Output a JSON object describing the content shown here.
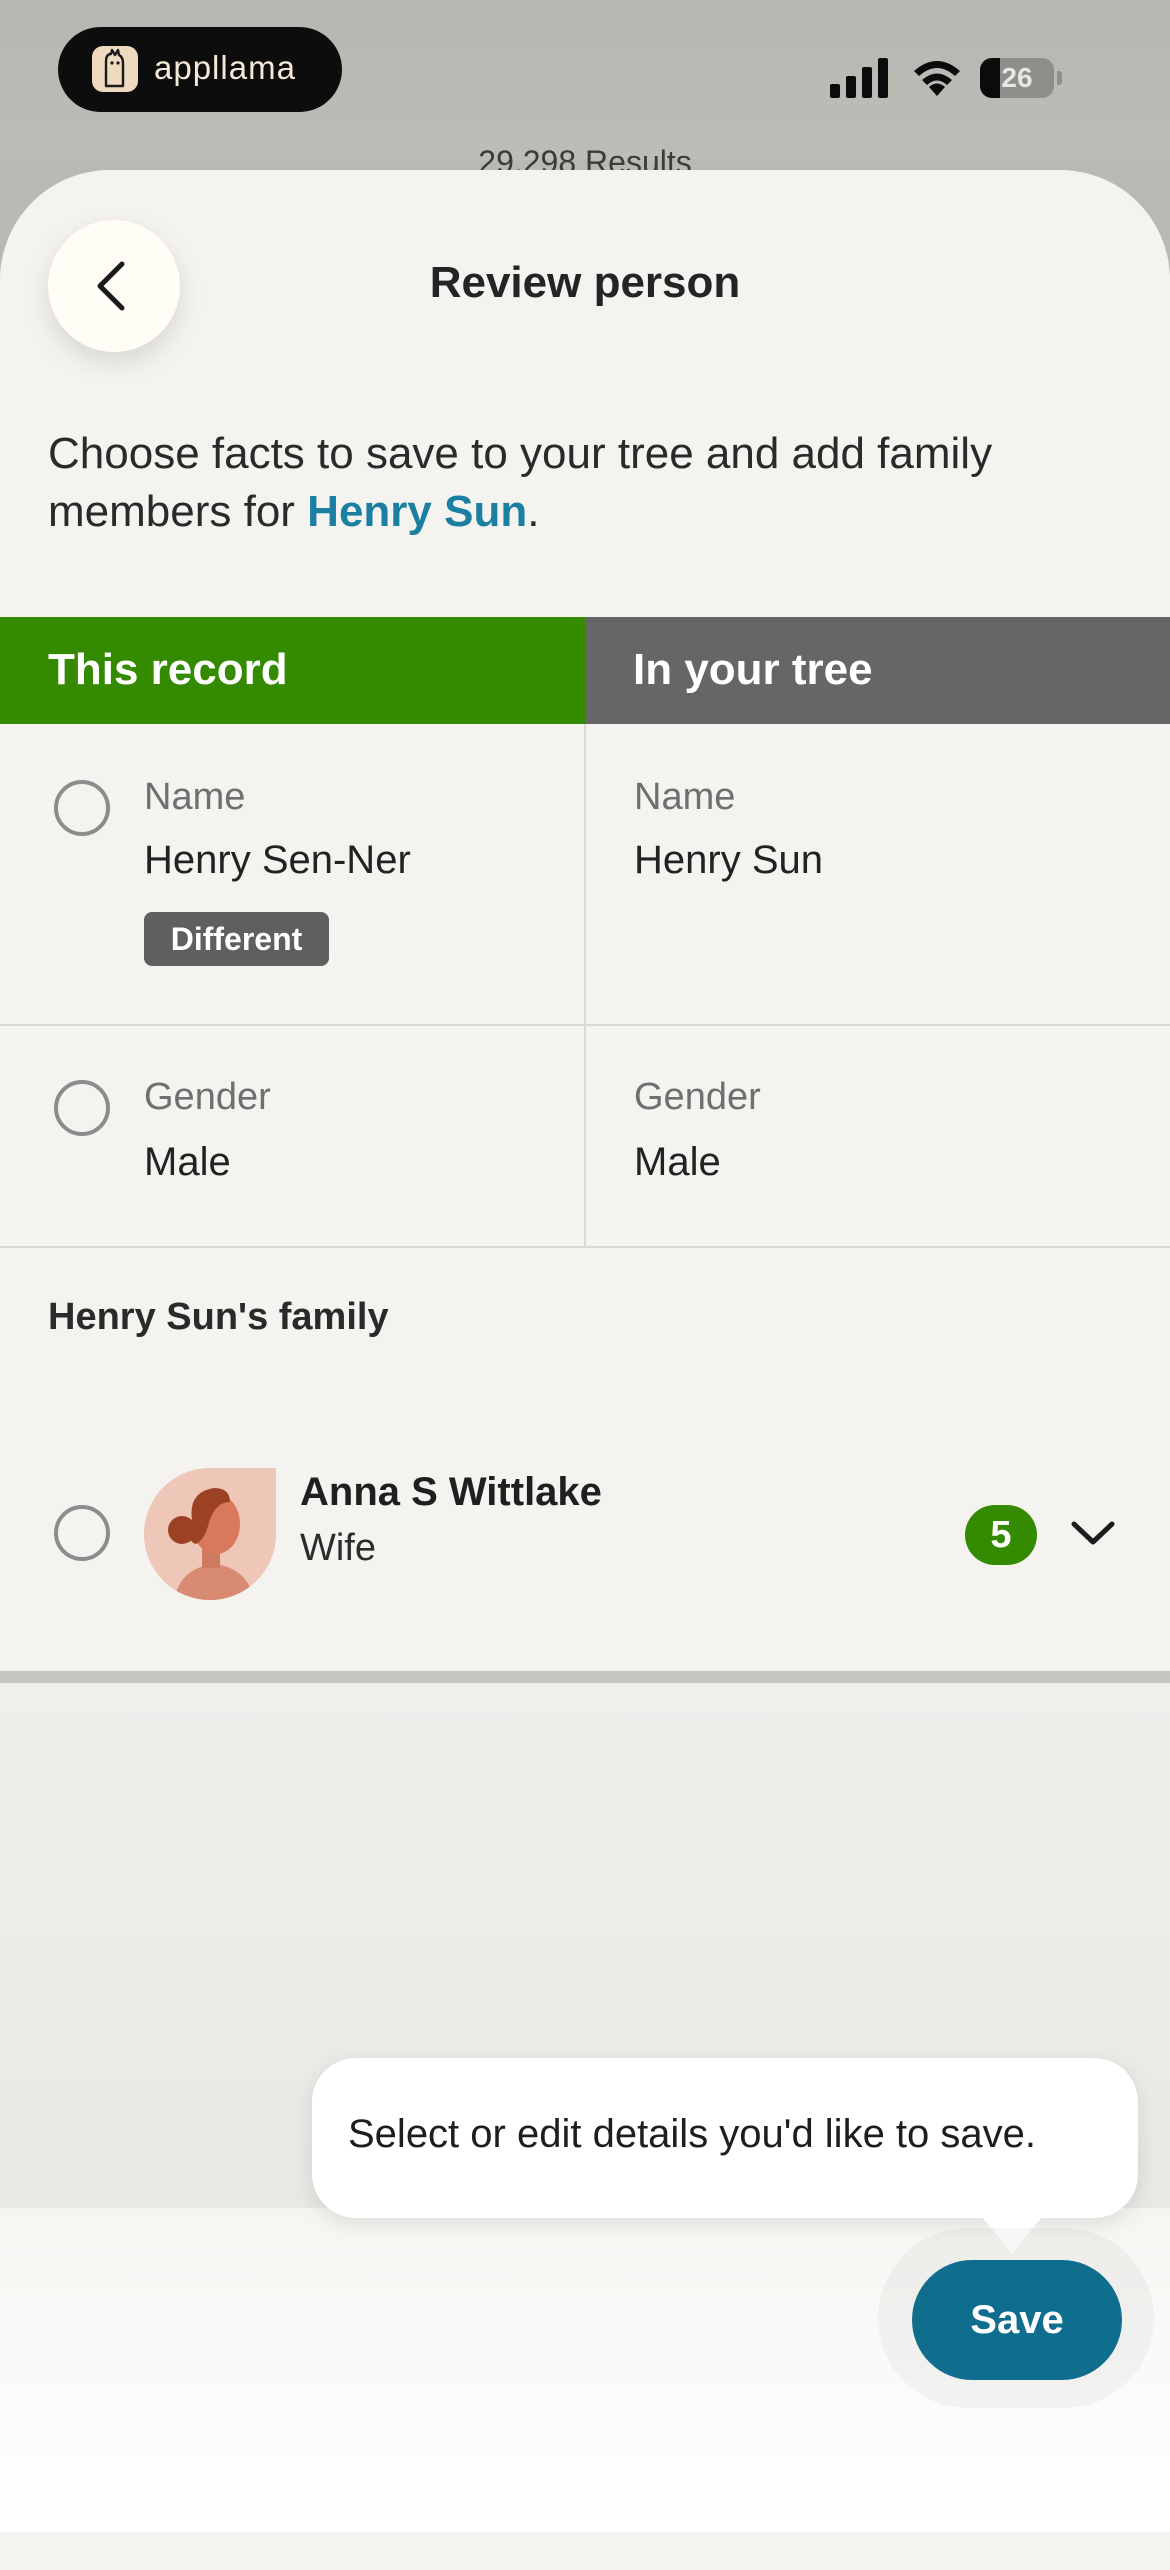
{
  "status_bar": {
    "app_pill_label": "appllama",
    "battery_level": "26"
  },
  "background": {
    "results_text": "29,298 Results"
  },
  "header": {
    "title": "Review person"
  },
  "intro": {
    "text": "Choose facts to save to your tree and add family members for ",
    "person_link": "Henry Sun",
    "suffix": "."
  },
  "columns": {
    "left_header": "This record",
    "right_header": "In your tree"
  },
  "facts": [
    {
      "label": "Name",
      "record_value": "Henry Sen-Ner",
      "tree_label": "Name",
      "tree_value": "Henry Sun",
      "badge": "Different"
    },
    {
      "label": "Gender",
      "record_value": "Male",
      "tree_label": "Gender",
      "tree_value": "Male"
    }
  ],
  "family": {
    "section_title": "Henry Sun's family",
    "members": [
      {
        "name": "Anna S Wittlake",
        "relation": "Wife",
        "count": "5"
      }
    ]
  },
  "tooltip": {
    "text": "Select or edit details you'd like to save."
  },
  "actions": {
    "save_label": "Save"
  },
  "colors": {
    "record_header": "#348a00",
    "tree_header": "#666666",
    "accent_link": "#1a7fa0",
    "save_button": "#0f6e8d"
  }
}
